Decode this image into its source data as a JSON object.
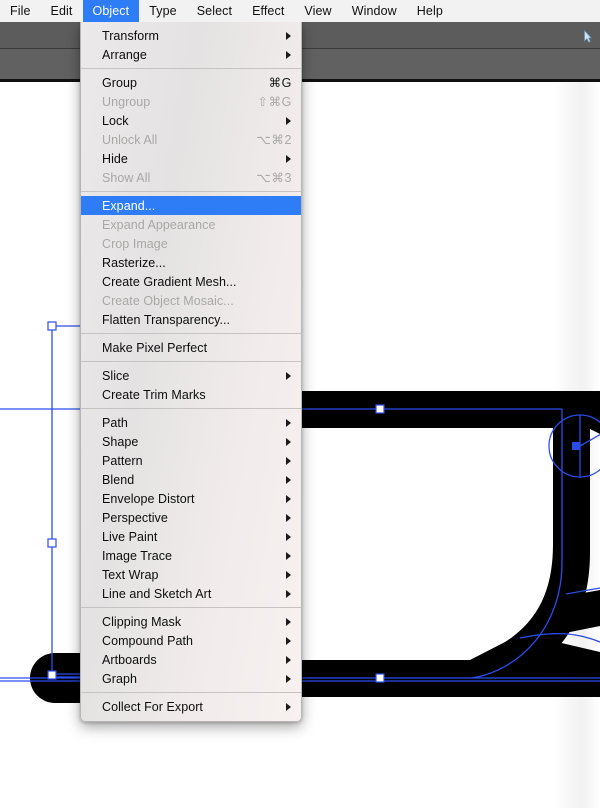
{
  "menubar": {
    "items": [
      {
        "label": "File",
        "active": false
      },
      {
        "label": "Edit",
        "active": false
      },
      {
        "label": "Object",
        "active": true
      },
      {
        "label": "Type",
        "active": false
      },
      {
        "label": "Select",
        "active": false
      },
      {
        "label": "Effect",
        "active": false
      },
      {
        "label": "View",
        "active": false
      },
      {
        "label": "Window",
        "active": false
      },
      {
        "label": "Help",
        "active": false
      }
    ],
    "active_color": "#2e7cf6",
    "background_color": "#f2f2f2"
  },
  "dropdown": {
    "title": "Object",
    "highlight_color": "#2e7cf6",
    "groups": [
      {
        "items": [
          {
            "label": "Transform",
            "shortcut": "",
            "submenu": true,
            "disabled": false
          },
          {
            "label": "Arrange",
            "shortcut": "",
            "submenu": true,
            "disabled": false
          }
        ]
      },
      {
        "items": [
          {
            "label": "Group",
            "shortcut": "⌘G",
            "submenu": false,
            "disabled": false
          },
          {
            "label": "Ungroup",
            "shortcut": "⇧⌘G",
            "submenu": false,
            "disabled": true
          },
          {
            "label": "Lock",
            "shortcut": "",
            "submenu": true,
            "disabled": false
          },
          {
            "label": "Unlock All",
            "shortcut": "⌥⌘2",
            "submenu": false,
            "disabled": true
          },
          {
            "label": "Hide",
            "shortcut": "",
            "submenu": true,
            "disabled": false
          },
          {
            "label": "Show All",
            "shortcut": "⌥⌘3",
            "submenu": false,
            "disabled": true
          }
        ]
      },
      {
        "items": [
          {
            "label": "Expand...",
            "shortcut": "",
            "submenu": false,
            "disabled": false,
            "highlight": true
          },
          {
            "label": "Expand Appearance",
            "shortcut": "",
            "submenu": false,
            "disabled": true
          },
          {
            "label": "Crop Image",
            "shortcut": "",
            "submenu": false,
            "disabled": true
          },
          {
            "label": "Rasterize...",
            "shortcut": "",
            "submenu": false,
            "disabled": false
          },
          {
            "label": "Create Gradient Mesh...",
            "shortcut": "",
            "submenu": false,
            "disabled": false
          },
          {
            "label": "Create Object Mosaic...",
            "shortcut": "",
            "submenu": false,
            "disabled": true
          },
          {
            "label": "Flatten Transparency...",
            "shortcut": "",
            "submenu": false,
            "disabled": false
          }
        ]
      },
      {
        "items": [
          {
            "label": "Make Pixel Perfect",
            "shortcut": "",
            "submenu": false,
            "disabled": false
          }
        ]
      },
      {
        "items": [
          {
            "label": "Slice",
            "shortcut": "",
            "submenu": true,
            "disabled": false
          },
          {
            "label": "Create Trim Marks",
            "shortcut": "",
            "submenu": false,
            "disabled": false
          }
        ]
      },
      {
        "items": [
          {
            "label": "Path",
            "shortcut": "",
            "submenu": true,
            "disabled": false
          },
          {
            "label": "Shape",
            "shortcut": "",
            "submenu": true,
            "disabled": false
          },
          {
            "label": "Pattern",
            "shortcut": "",
            "submenu": true,
            "disabled": false
          },
          {
            "label": "Blend",
            "shortcut": "",
            "submenu": true,
            "disabled": false
          },
          {
            "label": "Envelope Distort",
            "shortcut": "",
            "submenu": true,
            "disabled": false
          },
          {
            "label": "Perspective",
            "shortcut": "",
            "submenu": true,
            "disabled": false
          },
          {
            "label": "Live Paint",
            "shortcut": "",
            "submenu": true,
            "disabled": false
          },
          {
            "label": "Image Trace",
            "shortcut": "",
            "submenu": true,
            "disabled": false
          },
          {
            "label": "Text Wrap",
            "shortcut": "",
            "submenu": true,
            "disabled": false
          },
          {
            "label": "Line and Sketch Art",
            "shortcut": "",
            "submenu": true,
            "disabled": false
          }
        ]
      },
      {
        "items": [
          {
            "label": "Clipping Mask",
            "shortcut": "",
            "submenu": true,
            "disabled": false
          },
          {
            "label": "Compound Path",
            "shortcut": "",
            "submenu": true,
            "disabled": false
          },
          {
            "label": "Artboards",
            "shortcut": "",
            "submenu": true,
            "disabled": false
          },
          {
            "label": "Graph",
            "shortcut": "",
            "submenu": true,
            "disabled": false
          }
        ]
      },
      {
        "items": [
          {
            "label": "Collect For Export",
            "shortcut": "",
            "submenu": true,
            "disabled": false
          }
        ]
      }
    ]
  },
  "canvas": {
    "background_color": "#ffffff",
    "artwork_fill": "#000000",
    "selection_color": "#2b4ef0",
    "anchor_fill": "#ffffff",
    "description": "Black vector mug/cup outline artwork with blue selection paths, square anchor points and a circular live-shape widget"
  },
  "toolbar": {
    "background_color": "#5c5c5c",
    "secondary_color": "#616161"
  }
}
